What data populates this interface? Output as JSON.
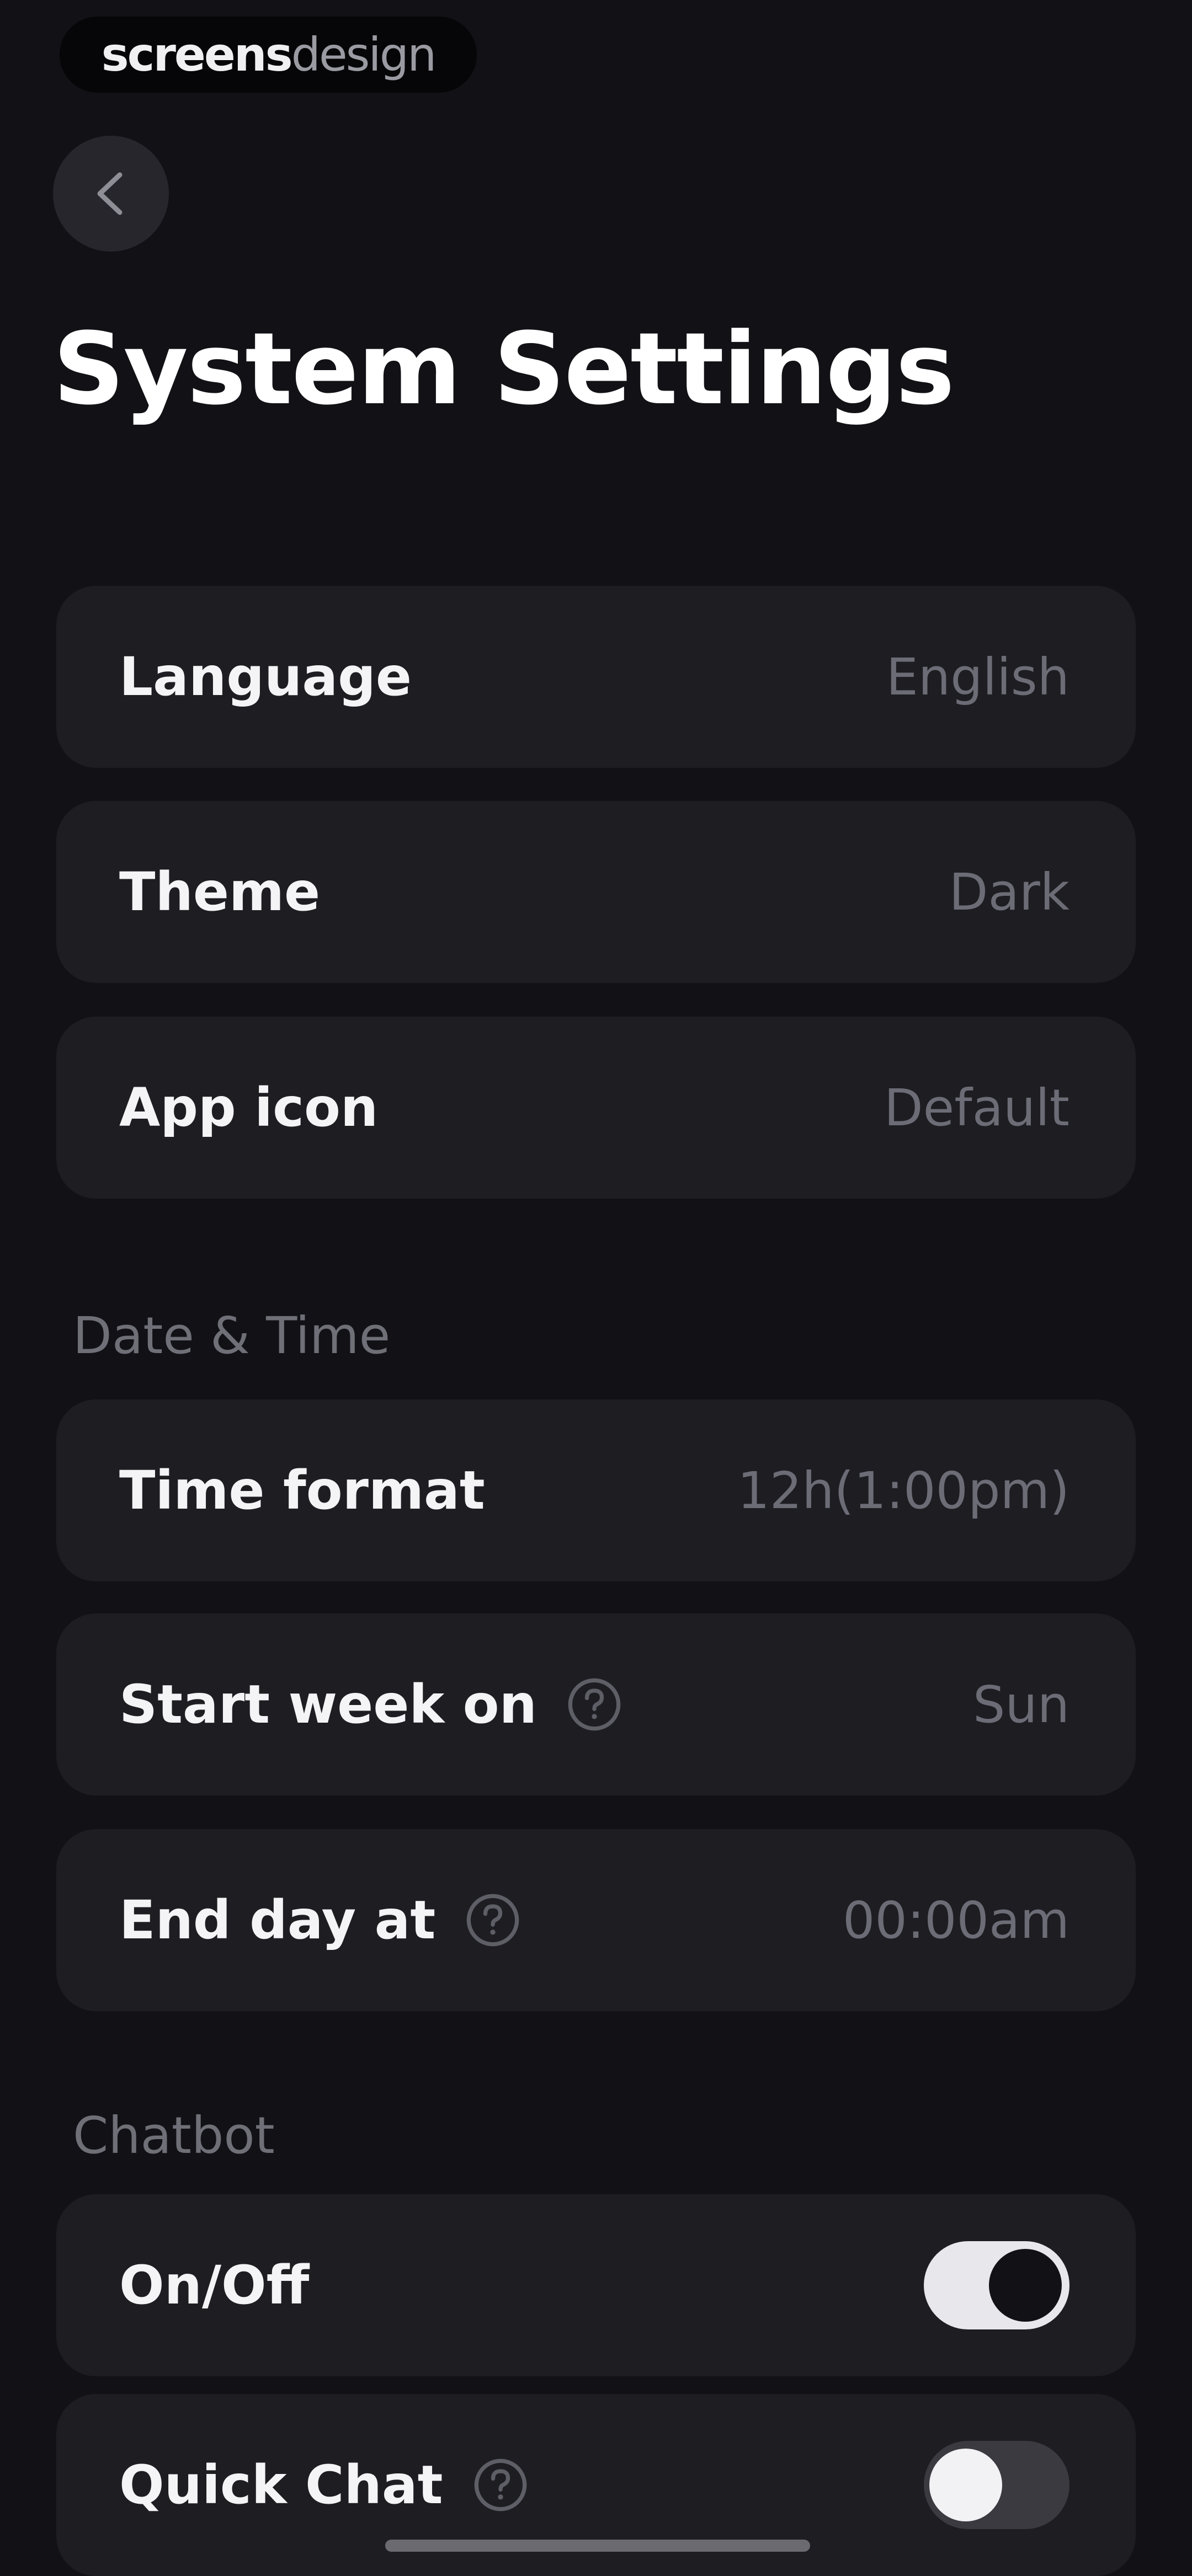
{
  "watermark": {
    "part1": "screens",
    "part2": "design"
  },
  "header": {
    "back_icon": "chevron-left-icon",
    "title": "System Settings"
  },
  "general": [
    {
      "label": "Language",
      "value": "English"
    },
    {
      "label": "Theme",
      "value": "Dark"
    },
    {
      "label": "App icon",
      "value": "Default"
    }
  ],
  "date_time": {
    "section_title": "Date & Time",
    "rows": [
      {
        "label": "Time format",
        "value": "12h(1:00pm)",
        "help": false
      },
      {
        "label": "Start week on",
        "value": "Sun",
        "help": true
      },
      {
        "label": "End day at",
        "value": "00:00am",
        "help": true
      }
    ]
  },
  "chatbot": {
    "section_title": "Chatbot",
    "rows": [
      {
        "label": "On/Off",
        "enabled": true,
        "help": false
      },
      {
        "label": "Quick Chat",
        "enabled": false,
        "help": true
      }
    ]
  },
  "icons": {
    "help": "question-circle-icon"
  },
  "colors": {
    "background": "#111116",
    "card": "#1d1d22",
    "value_text": "#6c6c76",
    "toggle_on": "#e8e8ec",
    "toggle_off": "#3a3a40"
  }
}
